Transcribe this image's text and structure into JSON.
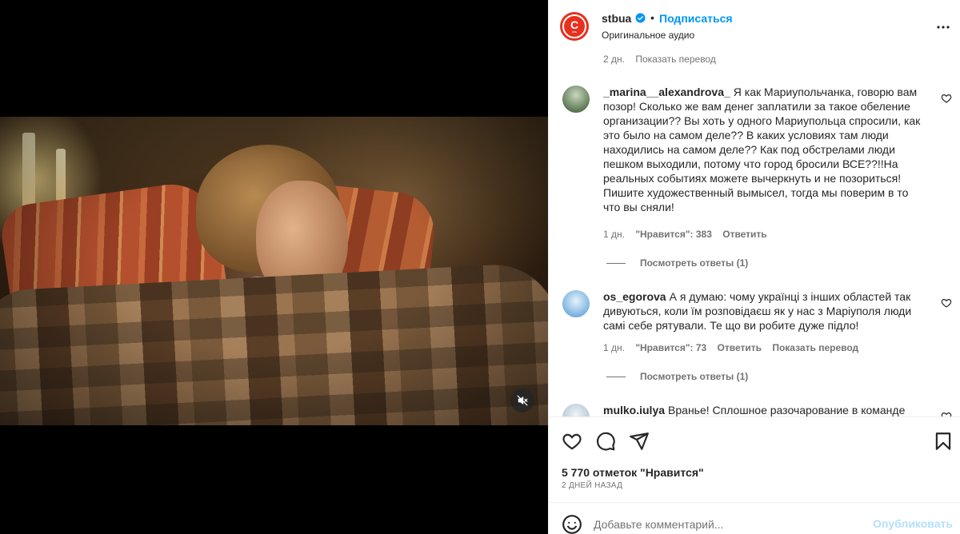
{
  "post": {
    "username": "stbua",
    "verified_icon": "verified-badge-icon",
    "separator": "•",
    "follow_label": "Подписаться",
    "audio_label": "Оригинальное аудио",
    "logo": {
      "big": "С",
      "small": "СТБ"
    }
  },
  "top_meta": {
    "time": "2 дн.",
    "translate": "Показать перевод"
  },
  "comments": [
    {
      "username": "_marina__alexandrova_",
      "text": "Я как Мариупольчанка, говорю вам позор! Сколько же вам денег заплатили за такое обеление организации?? Вы хоть у одного Мариупольца спросили, как это было на самом деле?? В каких условиях там люди находились на самом деле?? Как под обстрелами люди пешком выходили, потому что город бросили ВСЕ??!!На реальных событиях можете вычеркнуть и не позориться! Пишите художественный вымысел, тогда мы поверим в то что вы сняли!",
      "time": "1 дн.",
      "likes": "\"Нравится\": 383",
      "reply": "Ответить",
      "translate": "",
      "view_replies": "Посмотреть ответы (1)"
    },
    {
      "username": "os_egorova",
      "text": "А я думаю: чому українці з інших областей так дивуються, коли їм розповідаєш як у нас з Маріуполя люди самі себе рятували. Те що ви робите дуже підло!",
      "time": "1 дн.",
      "likes": "\"Нравится\": 73",
      "reply": "Ответить",
      "translate": "Показать перевод",
      "view_replies": "Посмотреть ответы (1)"
    },
    {
      "username": "mulko.iulya",
      "text": "Вранье! Сплошное разочарование в команде"
    }
  ],
  "engagement": {
    "likes_label": "5 770 отметок \"Нравится\"",
    "date_label": "2 ДНЕЙ НАЗАД"
  },
  "composer": {
    "placeholder": "Добавьте комментарий...",
    "publish_label": "Опубликовать"
  },
  "colors": {
    "accent": "#0095f6",
    "brand": "#e8301c",
    "muted": "#737373",
    "publish_disabled": "#b2dffc"
  }
}
